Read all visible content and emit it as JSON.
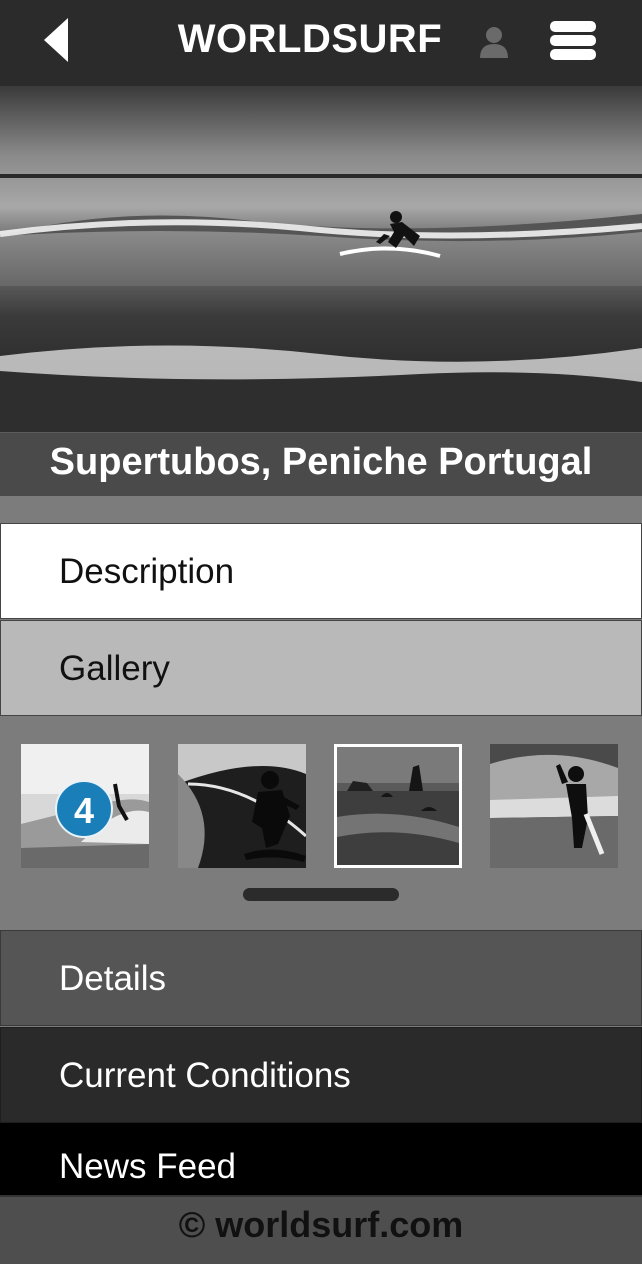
{
  "header": {
    "title": "WORLDSURF",
    "back_icon": "chevron-left-icon",
    "user_icon": "user-icon",
    "menu_icon": "hamburger-menu-icon"
  },
  "spot": {
    "title": "Supertubos, Peniche Portugal"
  },
  "sections": {
    "description": "Description",
    "gallery": "Gallery",
    "details": "Details",
    "conditions": "Current Conditions",
    "news": "News Feed"
  },
  "gallery": {
    "badge_count": "4",
    "thumbnails": [
      "surfer-splash",
      "surfer-silhouette",
      "rocky-coast",
      "surfer-woman"
    ]
  },
  "footer": {
    "copyright": "© worldsurf.com"
  },
  "colors": {
    "header_bg": "#2b2b2b",
    "badge": "#1a7fb8",
    "footer_bg": "#4e4e4e"
  }
}
